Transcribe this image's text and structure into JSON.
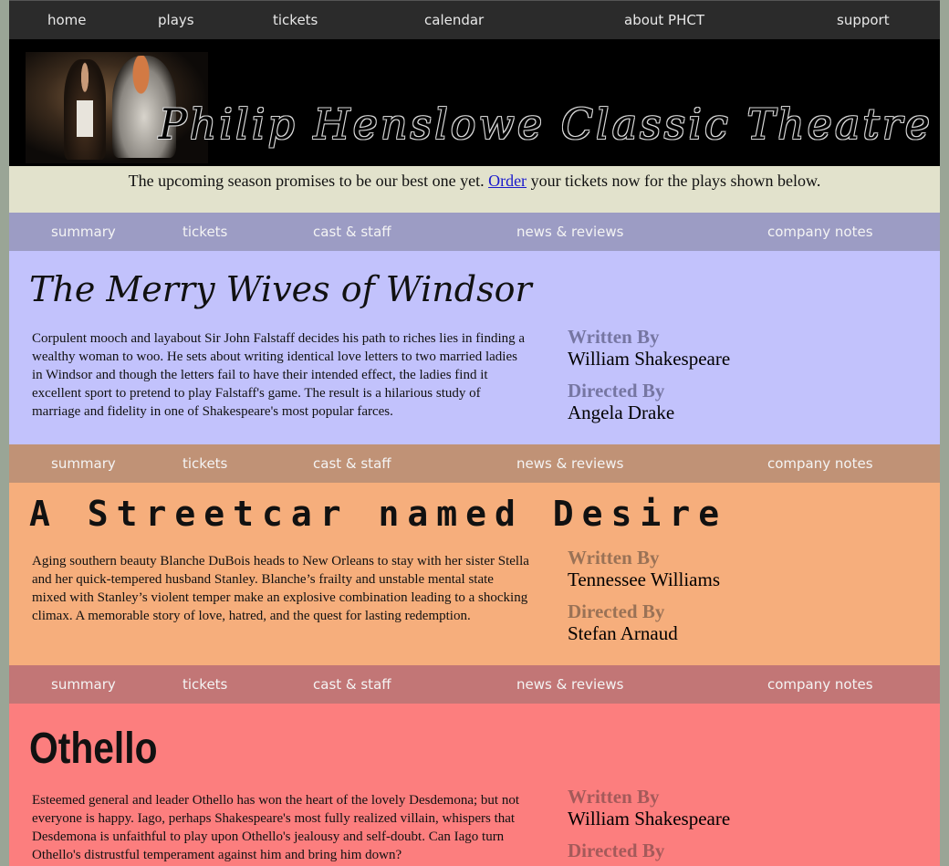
{
  "topnav": {
    "items": [
      {
        "label": "home"
      },
      {
        "label": "plays"
      },
      {
        "label": "tickets"
      },
      {
        "label": "calendar"
      },
      {
        "label": "about PHCT"
      },
      {
        "label": "support"
      }
    ]
  },
  "banner": {
    "title": "Philip Henslowe Classic Theatre"
  },
  "intro": {
    "before": "The upcoming season promises to be our best one yet. ",
    "link": "Order",
    "after": " your tickets now for the plays shown below."
  },
  "subnav_items": [
    "summary",
    "tickets",
    "cast & staff",
    "news & reviews",
    "company notes"
  ],
  "plays": [
    {
      "title": "The Merry Wives of Windsor",
      "summary": "Corpulent mooch and layabout Sir John Falstaff decides his path to riches lies in finding a wealthy woman to woo. He sets about writing identical love letters to two married ladies in Windsor and though the letters fail to have their intended effect, the ladies find it excellent sport to pretend to play Falstaff's game. The result is a hilarious study of marriage and fidelity in one of Shakespeare's most popular farces.",
      "written_label": "Written By",
      "written_by": "William Shakespeare",
      "directed_label": "Directed By",
      "directed_by": "Angela Drake",
      "colors": {
        "nav": "#9c9cc4",
        "body": "#c2c2fc",
        "label": "#7676a2"
      }
    },
    {
      "title": "A Streetcar named Desire",
      "summary": "Aging southern beauty Blanche DuBois heads to New Orleans to stay with her sister Stella and her quick-tempered husband Stanley. Blanche’s frailty and unstable mental state mixed with Stanley’s violent temper make an explosive combination leading to a shocking climax. A memorable story of love, hatred, and the quest for lasting redemption.",
      "written_label": "Written By",
      "written_by": "Tennessee Williams",
      "directed_label": "Directed By",
      "directed_by": "Stefan Arnaud",
      "colors": {
        "nav": "#c09276",
        "body": "#f6ae7c",
        "label": "#9a7256"
      }
    },
    {
      "title": "Othello",
      "summary": "Esteemed general and leader Othello has won the heart of the lovely Desdemona; but not everyone is happy. Iago, perhaps Shakespeare's most fully realized villain, whispers that Desdemona is unfaithful to play upon Othello's jealousy and self-doubt. Can Iago turn Othello's distrustful temperament against him and bring him down?",
      "written_label": "Written By",
      "written_by": "William Shakespeare",
      "directed_label": "Directed By",
      "directed_by": "",
      "colors": {
        "nav": "#c27676",
        "body": "#fc7e7e",
        "label": "#a45a5a"
      }
    }
  ]
}
